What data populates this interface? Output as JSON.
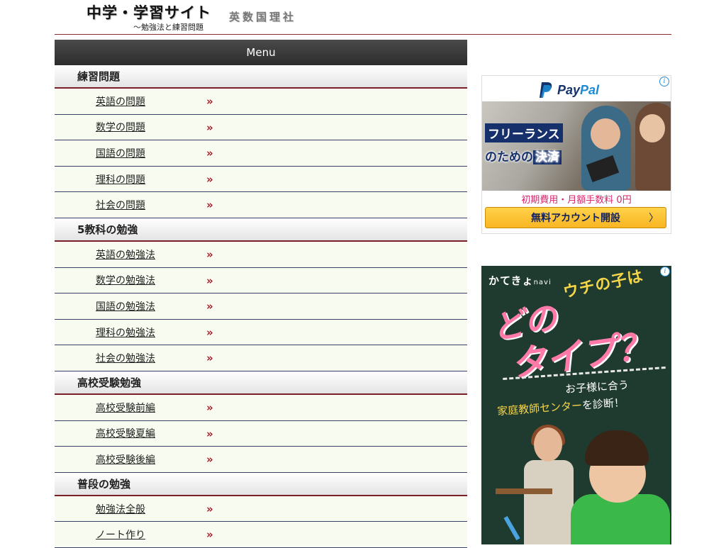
{
  "header": {
    "site_title": "中学・学習サイト",
    "site_subtitle": "～勉強法と練習問題",
    "subjects": "英数国理社"
  },
  "menu": {
    "title": "Menu",
    "arrow": "»",
    "sections": [
      {
        "heading": "練習問題",
        "items": [
          "英語の問題",
          "数学の問題",
          "国語の問題",
          "理科の問題",
          "社会の問題"
        ]
      },
      {
        "heading": "5教科の勉強",
        "items": [
          "英語の勉強法",
          "数学の勉強法",
          "国語の勉強法",
          "理科の勉強法",
          "社会の勉強法"
        ]
      },
      {
        "heading": "高校受験勉強",
        "items": [
          "高校受験前編",
          "高校受験夏編",
          "高校受験後編"
        ]
      },
      {
        "heading": "普段の勉強",
        "items": [
          "勉強法全般",
          "ノート作り"
        ]
      }
    ]
  },
  "ads": {
    "adchoice_icon": "info-icon",
    "paypal": {
      "logo_text_1": "Pay",
      "logo_text_2": "Pal",
      "headline_1": "フリーランス",
      "headline_2a": "のための",
      "headline_2b": "決済",
      "fee_text": "初期費用・月額手数料 0円",
      "button_label": "無料アカウント開設",
      "button_chevron": "〉"
    },
    "kateikyo": {
      "logo": "かてきょ",
      "logo_small": "navi",
      "question_1": "ウチの子は",
      "big_1": "どの",
      "big_2": "タイプ？",
      "sub_1": "お子様に合う",
      "sub_2a": "家庭教師センター",
      "sub_2b": "を診断！"
    }
  },
  "colors": {
    "menu_bar": "#333333",
    "section_rule": "#7a1f2a",
    "item_bg": "#f8fcf0",
    "item_rule": "#3a3f66",
    "arrow": "#a01a2a",
    "paypal_navy": "#14326b",
    "paypal_blue": "#1d8bd3"
  }
}
